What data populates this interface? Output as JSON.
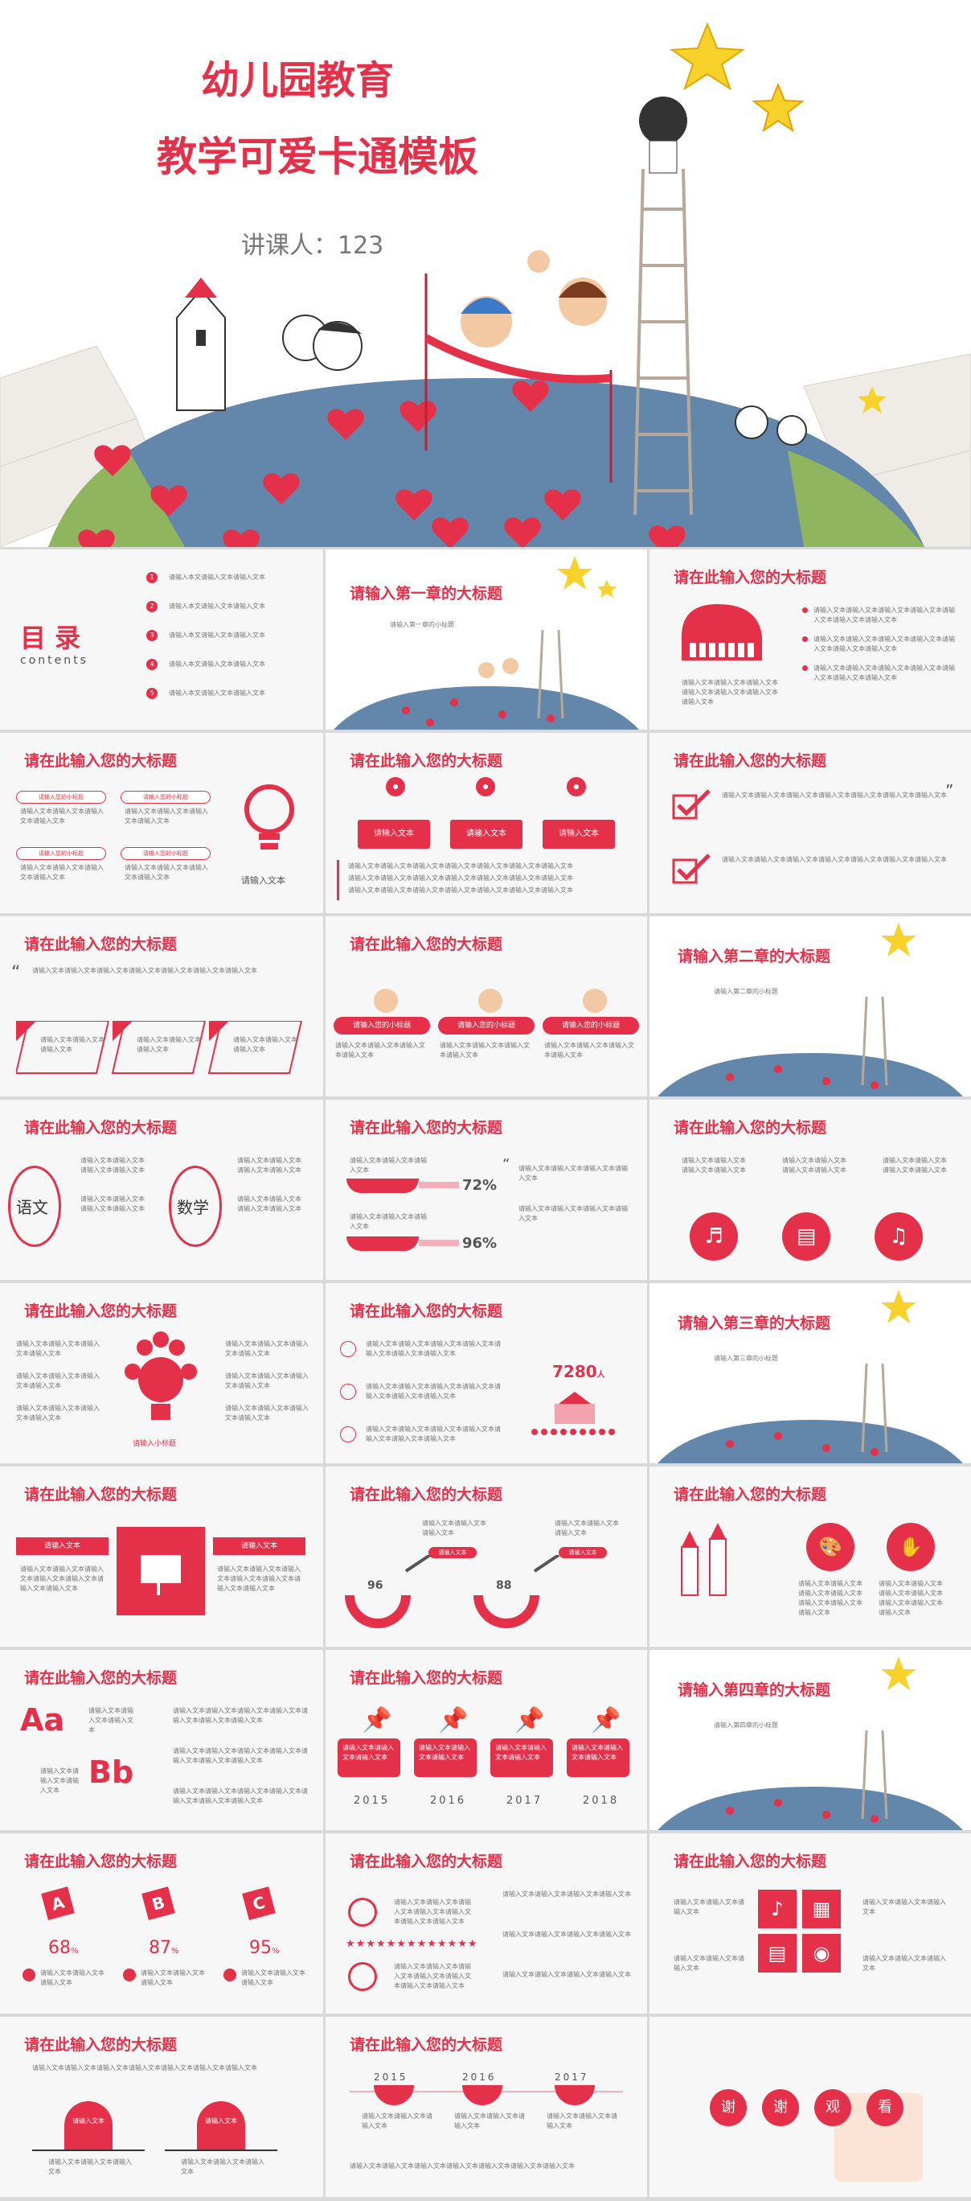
{
  "hero": {
    "title1": "幼儿园教育",
    "title2": "教学可爱卡通模板",
    "speaker": "讲课人：123"
  },
  "toc": {
    "title": "目 录",
    "sub": "contents",
    "items": [
      "请输入本文请输入文本请输入文本",
      "请输入本文请输入文本请输入文本",
      "请输入本文请输入文本请输入文本",
      "请输入本文请输入文本请输入文本",
      "请输入本文请输入文本请输入文本"
    ],
    "nums": [
      "1",
      "2",
      "3",
      "4",
      "5"
    ]
  },
  "section": {
    "ch1": "请输入第一章的大标题",
    "ch1_sub": "请输入第一章的小标题",
    "ch2": "请输入第二章的大标题",
    "ch2_sub": "请输入第二章的小标题",
    "ch3": "请输入第三章的大标题",
    "ch3_sub": "请输入第三章的小标题",
    "ch4": "请输入第四章的大标题",
    "ch4_sub": "请输入第四章的小标题"
  },
  "common": {
    "heading": "请在此输入您的大标题",
    "heading2": "请在此输入您的大标题",
    "text_short": "请输入文本",
    "text_line": "请输入文本请输入文本请输入文本请输入文本请输入文本请输入文本请输入文本",
    "text_mid": "请输入文本请输入文本请输入文本",
    "bullet": "请输入文本请输入文本请输入文本请输入文本",
    "small_title": "请输入小标题",
    "sub_small": "请输入您的小标题"
  },
  "subjects": {
    "a": "语文",
    "b": "数学"
  },
  "stats": {
    "p1": "72%",
    "p2": "96%",
    "people": "7280",
    "people_unit": "人",
    "g1": "96",
    "g2": "88",
    "pct1": "68",
    "pct2": "87",
    "pct3": "95"
  },
  "years": {
    "y1": "2015",
    "y2": "2016",
    "y3": "2017",
    "y4": "2018"
  },
  "letters": {
    "a": "A",
    "b": "B",
    "c": "C",
    "aa": "Aa",
    "bb": "Bb"
  },
  "ending": {
    "c1": "谢",
    "c2": "谢",
    "c3": "观",
    "c4": "看"
  },
  "colors": {
    "accent": "#e5304a",
    "earth": "#5b84a8",
    "bg": "#f7f7f7"
  }
}
